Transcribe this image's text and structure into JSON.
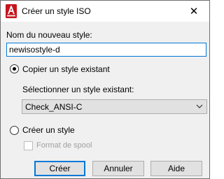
{
  "window": {
    "title": "Créer un style ISO",
    "close_glyph": "✕",
    "app_icon": "autocad-app-icon",
    "app_icon_color": "#c4161c"
  },
  "form": {
    "name_label": "Nom du nouveau style:",
    "name_value": "newisostyle-d",
    "copy_option_label": "Copier un style existant",
    "copy_option_selected": true,
    "select_label": "Sélectionner un style existant:",
    "select_value": "Check_ANSI-C",
    "create_option_label": "Créer un style",
    "create_option_selected": false,
    "spool_label": "Format de spool",
    "spool_checked": false,
    "spool_enabled": false
  },
  "buttons": {
    "create": "Créer",
    "cancel": "Annuler",
    "help": "Aide"
  },
  "colors": {
    "accent": "#0078d7",
    "window_bg": "#f0f0f0",
    "disabled_text": "#a0a0a0"
  }
}
